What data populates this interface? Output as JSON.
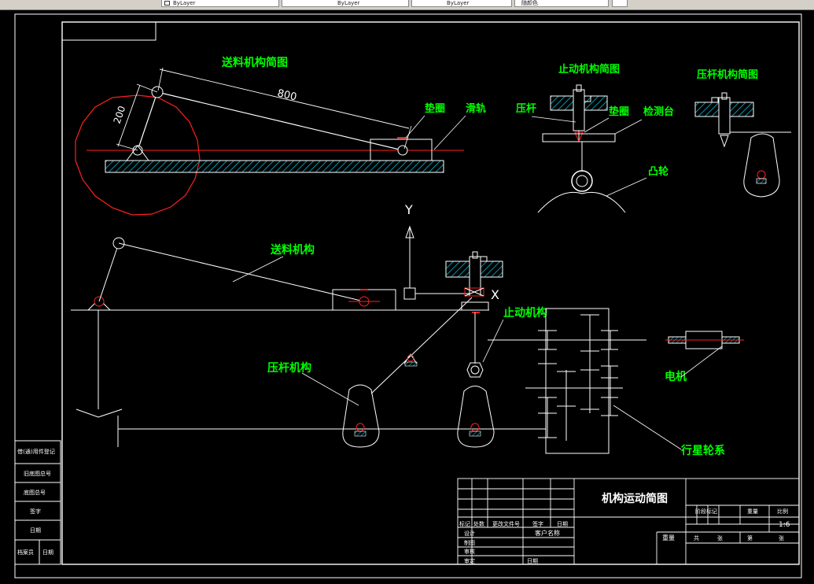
{
  "toolbar": {
    "tabs": [
      {
        "label": "ByLayer"
      },
      {
        "label": "ByLayer"
      },
      {
        "label": "ByLayer"
      },
      {
        "label": "随颜色"
      }
    ]
  },
  "drawing": {
    "top_view_title": "送料机构简图",
    "dim_800": "800",
    "dim_200": "200",
    "label_washer_top": "垫圈",
    "label_slide_rail": "滑轨",
    "stop_view_title": "止动机构简图",
    "label_press_rod": "压杆",
    "label_washer_stop": "垫圈",
    "label_test_bench": "检测台",
    "label_cam": "凸轮",
    "press_view_title": "压杆机构简图",
    "axis_y": "Y",
    "axis_x": "X",
    "label_feed_mechanism": "送料机构",
    "label_stop_mechanism": "止动机构",
    "label_press_mechanism": "压杆机构",
    "label_motor": "电机",
    "label_planetary": "行星轮系"
  },
  "title_block": {
    "drawing_title": "机构运动简图",
    "scale": "1:6",
    "col_headers": [
      "标记",
      "处数",
      "更改文件号",
      "签字",
      "日期"
    ],
    "row_labels": [
      "设计",
      "制图",
      "审核",
      "审定"
    ],
    "customer_label": "客户名称",
    "date_label": "日期",
    "stage_labels": [
      "阶段标记",
      "重量",
      "比例"
    ],
    "weight_label": "重量",
    "sheet_total": "共",
    "sheet_label": "张",
    "sheet_no": "第",
    "sheet_label2": "张"
  },
  "side_block": {
    "rows": [
      "借(通)用件登记",
      "旧底图总号",
      "底图总号",
      "签字",
      "日期"
    ],
    "bottom": [
      "档案员",
      "日期"
    ]
  },
  "colors": {
    "background": "#000000",
    "line": "#ffffff",
    "label": "#00ff00",
    "center_line": "#ff0000",
    "hatch": "#00bcd4"
  }
}
